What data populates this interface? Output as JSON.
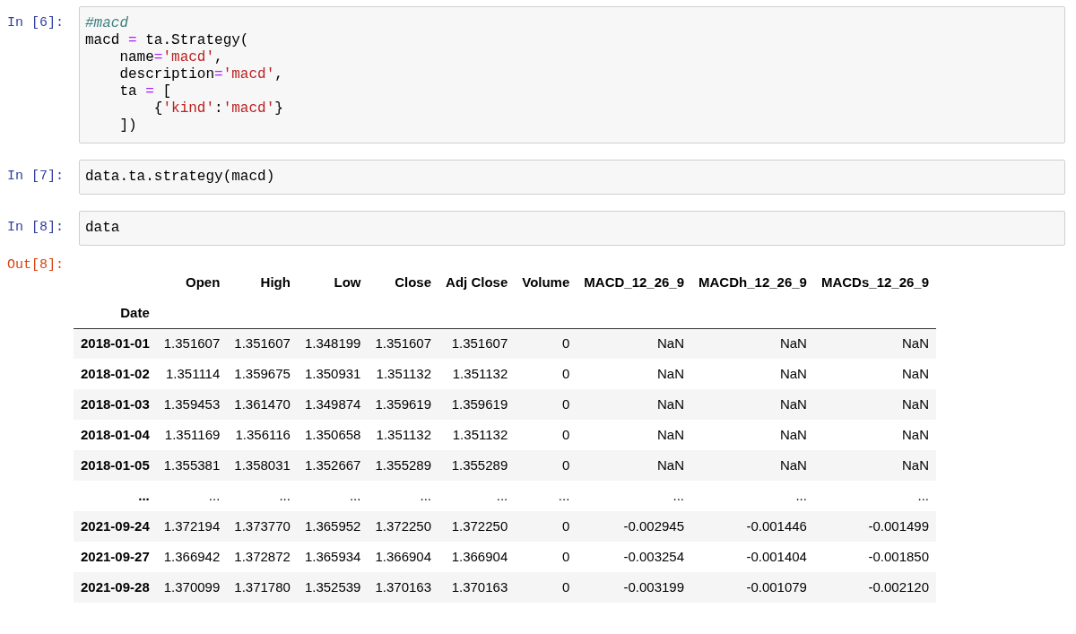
{
  "cells": [
    {
      "prompt": "In [6]:",
      "lines": [
        [
          {
            "kind": "comment",
            "text": "#macd"
          }
        ],
        [
          {
            "kind": "plain",
            "text": "macd "
          },
          {
            "kind": "op",
            "text": "="
          },
          {
            "kind": "plain",
            "text": " ta.Strategy("
          }
        ],
        [
          {
            "kind": "plain",
            "text": "    name"
          },
          {
            "kind": "op",
            "text": "="
          },
          {
            "kind": "string",
            "text": "'macd'"
          },
          {
            "kind": "plain",
            "text": ","
          }
        ],
        [
          {
            "kind": "plain",
            "text": "    description"
          },
          {
            "kind": "op",
            "text": "="
          },
          {
            "kind": "string",
            "text": "'macd'"
          },
          {
            "kind": "plain",
            "text": ","
          }
        ],
        [
          {
            "kind": "plain",
            "text": "    ta "
          },
          {
            "kind": "op",
            "text": "="
          },
          {
            "kind": "plain",
            "text": " ["
          }
        ],
        [
          {
            "kind": "plain",
            "text": "        {"
          },
          {
            "kind": "string",
            "text": "'kind'"
          },
          {
            "kind": "plain",
            "text": ":"
          },
          {
            "kind": "string",
            "text": "'macd'"
          },
          {
            "kind": "plain",
            "text": "}"
          }
        ],
        [
          {
            "kind": "plain",
            "text": "    ])"
          }
        ]
      ]
    },
    {
      "prompt": "In [7]:",
      "lines": [
        [
          {
            "kind": "plain",
            "text": "data.ta.strategy(macd)"
          }
        ]
      ]
    },
    {
      "prompt": "In [8]:",
      "lines": [
        [
          {
            "kind": "plain",
            "text": "data"
          }
        ]
      ]
    }
  ],
  "output": {
    "prompt": "Out[8]:",
    "table": {
      "columns": [
        "Open",
        "High",
        "Low",
        "Close",
        "Adj Close",
        "Volume",
        "MACD_12_26_9",
        "MACDh_12_26_9",
        "MACDs_12_26_9"
      ],
      "index_name": "Date",
      "rows": [
        {
          "index": "2018-01-01",
          "cells": [
            "1.351607",
            "1.351607",
            "1.348199",
            "1.351607",
            "1.351607",
            "0",
            "NaN",
            "NaN",
            "NaN"
          ]
        },
        {
          "index": "2018-01-02",
          "cells": [
            "1.351114",
            "1.359675",
            "1.350931",
            "1.351132",
            "1.351132",
            "0",
            "NaN",
            "NaN",
            "NaN"
          ]
        },
        {
          "index": "2018-01-03",
          "cells": [
            "1.359453",
            "1.361470",
            "1.349874",
            "1.359619",
            "1.359619",
            "0",
            "NaN",
            "NaN",
            "NaN"
          ]
        },
        {
          "index": "2018-01-04",
          "cells": [
            "1.351169",
            "1.356116",
            "1.350658",
            "1.351132",
            "1.351132",
            "0",
            "NaN",
            "NaN",
            "NaN"
          ]
        },
        {
          "index": "2018-01-05",
          "cells": [
            "1.355381",
            "1.358031",
            "1.352667",
            "1.355289",
            "1.355289",
            "0",
            "NaN",
            "NaN",
            "NaN"
          ]
        },
        {
          "index": "...",
          "cells": [
            "...",
            "...",
            "...",
            "...",
            "...",
            "...",
            "...",
            "...",
            "..."
          ]
        },
        {
          "index": "2021-09-24",
          "cells": [
            "1.372194",
            "1.373770",
            "1.365952",
            "1.372250",
            "1.372250",
            "0",
            "-0.002945",
            "-0.001446",
            "-0.001499"
          ]
        },
        {
          "index": "2021-09-27",
          "cells": [
            "1.366942",
            "1.372872",
            "1.365934",
            "1.366904",
            "1.366904",
            "0",
            "-0.003254",
            "-0.001404",
            "-0.001850"
          ]
        },
        {
          "index": "2021-09-28",
          "cells": [
            "1.370099",
            "1.371780",
            "1.352539",
            "1.370163",
            "1.370163",
            "0",
            "-0.003199",
            "-0.001079",
            "-0.002120"
          ]
        }
      ]
    }
  }
}
